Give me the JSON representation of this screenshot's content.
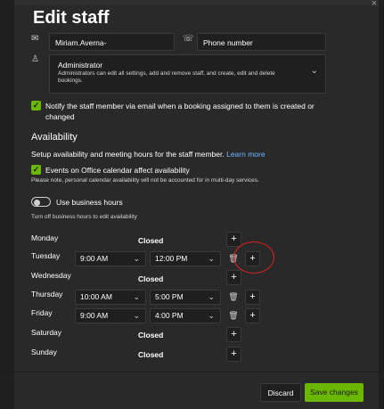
{
  "dialog": {
    "title": "Edit staff",
    "close_glyph": "×"
  },
  "contact": {
    "email_value": "Miriam.Averna-Joint@warwick.ac.uk",
    "phone_placeholder": "Phone number",
    "mail_icon": "mail-icon",
    "phone_icon": "phone-icon",
    "person_icon": "person-icon"
  },
  "role": {
    "title": "Administrator",
    "description": "Administrators can edit all settings, add and remove staff, and create, edit and delete bookings."
  },
  "notify": {
    "checked": true,
    "label": "Notify the staff member via email when a booking assigned to them is created or changed"
  },
  "availability": {
    "heading": "Availability",
    "description": "Setup availability and meeting hours for the staff member.",
    "learn_more": "Learn more",
    "office_checked": true,
    "office_label": "Events on Office calendar affect availability",
    "office_note": "Please note, personal calendar availability will not be accounted for in multi-day services.",
    "business_hours_on": false,
    "business_hours_label": "Use business hours",
    "business_hours_note": "Turn off business hours to edit availability"
  },
  "schedule": [
    {
      "day": "Monday",
      "status": "Closed"
    },
    {
      "day": "Tuesday",
      "start": "9:00 AM",
      "end": "12:00 PM"
    },
    {
      "day": "Wednesday",
      "status": "Closed"
    },
    {
      "day": "Thursday",
      "start": "10:00 AM",
      "end": "5:00 PM"
    },
    {
      "day": "Friday",
      "start": "9:00 AM",
      "end": "4:00 PM"
    },
    {
      "day": "Saturday",
      "status": "Closed"
    },
    {
      "day": "Sunday",
      "status": "Closed"
    }
  ],
  "buttons": {
    "add": "+",
    "discard": "Discard",
    "save": "Save changes"
  },
  "colors": {
    "accent": "#6bb700",
    "link": "#6bb6ff",
    "annotation": "#e02020"
  }
}
